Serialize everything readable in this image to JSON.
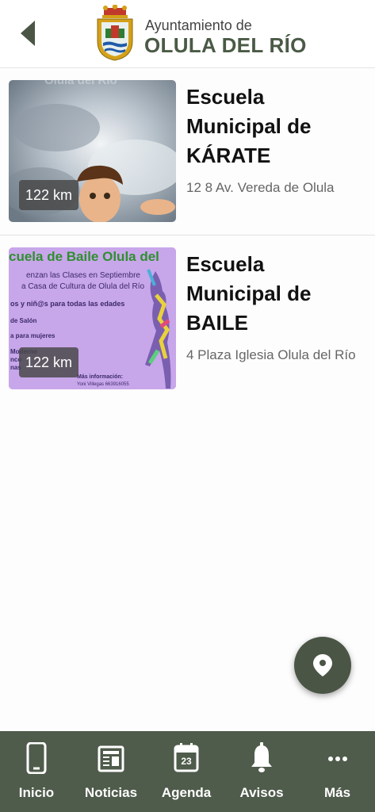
{
  "header": {
    "brand_top": "Ayuntamiento de",
    "brand_main": "OLULA DEL RÍO",
    "back_icon": "chevron-left-icon",
    "crest_icon": "coat-of-arms-icon"
  },
  "items": [
    {
      "title_lines": [
        "Escuela",
        "Municipal de",
        "KÁRATE"
      ],
      "address": "12 8 Av. Vereda de Olula",
      "distance": "122 km",
      "thumbnail_watermark": "Olula del Río"
    },
    {
      "title_lines": [
        "Escuela",
        "Municipal de",
        "BAILE"
      ],
      "address": "4 Plaza Iglesia Olula del Río",
      "distance": "122 km",
      "poster": {
        "heading": "cuela de Baile Olula del",
        "line1": "enzan las Clases en  Septiembre",
        "line2": "a Casa de Cultura de Olula del Río",
        "line3": "os y niñ@s para todas las edades",
        "line4": "de Salón",
        "line5": "a para mujeres",
        "line6": "Moderno",
        "line7": "nco",
        "line8": "nas",
        "info_title": "Más información:",
        "info_contact": "Yoni Villegas 663916055"
      }
    }
  ],
  "fab": {
    "icon": "map-pin-icon"
  },
  "tabbar": {
    "colors": {
      "background": "#4f5b4b",
      "text": "#ffffff"
    },
    "tabs": [
      {
        "label": "Inicio",
        "icon": "phone-icon"
      },
      {
        "label": "Noticias",
        "icon": "newspaper-icon"
      },
      {
        "label": "Agenda",
        "icon": "calendar-icon",
        "icon_text": "23"
      },
      {
        "label": "Avisos",
        "icon": "bell-icon"
      },
      {
        "label": "Más",
        "icon": "more-dots-icon"
      }
    ]
  }
}
